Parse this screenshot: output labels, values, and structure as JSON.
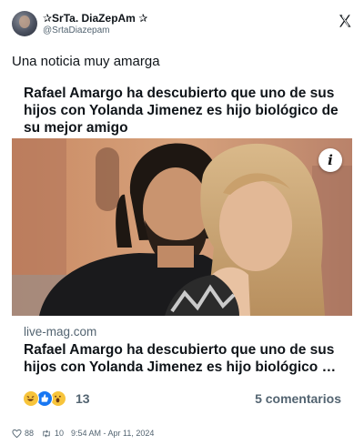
{
  "author": {
    "name": "✰SrTa. DiaZepAm ✰",
    "handle": "@SrtaDiazepam"
  },
  "tweet": {
    "text": "Una noticia muy amarga"
  },
  "card": {
    "headline": "Rafael Amargo ha descubierto que uno de sus hijos con Yolanda Jimenez es hijo biológico de su mejor amigo",
    "domain": "live-mag.com",
    "title": "Rafael Amargo ha descubierto que uno de sus hijos con Yolanda Jimenez es hijo biológico de su mejor amigo",
    "info_glyph": "i"
  },
  "reactions": {
    "count": "13",
    "icons": [
      "laugh-emoji",
      "like-emoji",
      "wow-emoji"
    ]
  },
  "comments": {
    "label": "5 comentarios"
  },
  "footer": {
    "likes": "88",
    "retweets": "10",
    "timestamp": "9:54 AM - Apr 11, 2024"
  },
  "colors": {
    "text_primary": "#0f1419",
    "text_secondary": "#536471",
    "like_blue": "#1877f2",
    "emoji_yellow": "#f7c43b"
  }
}
